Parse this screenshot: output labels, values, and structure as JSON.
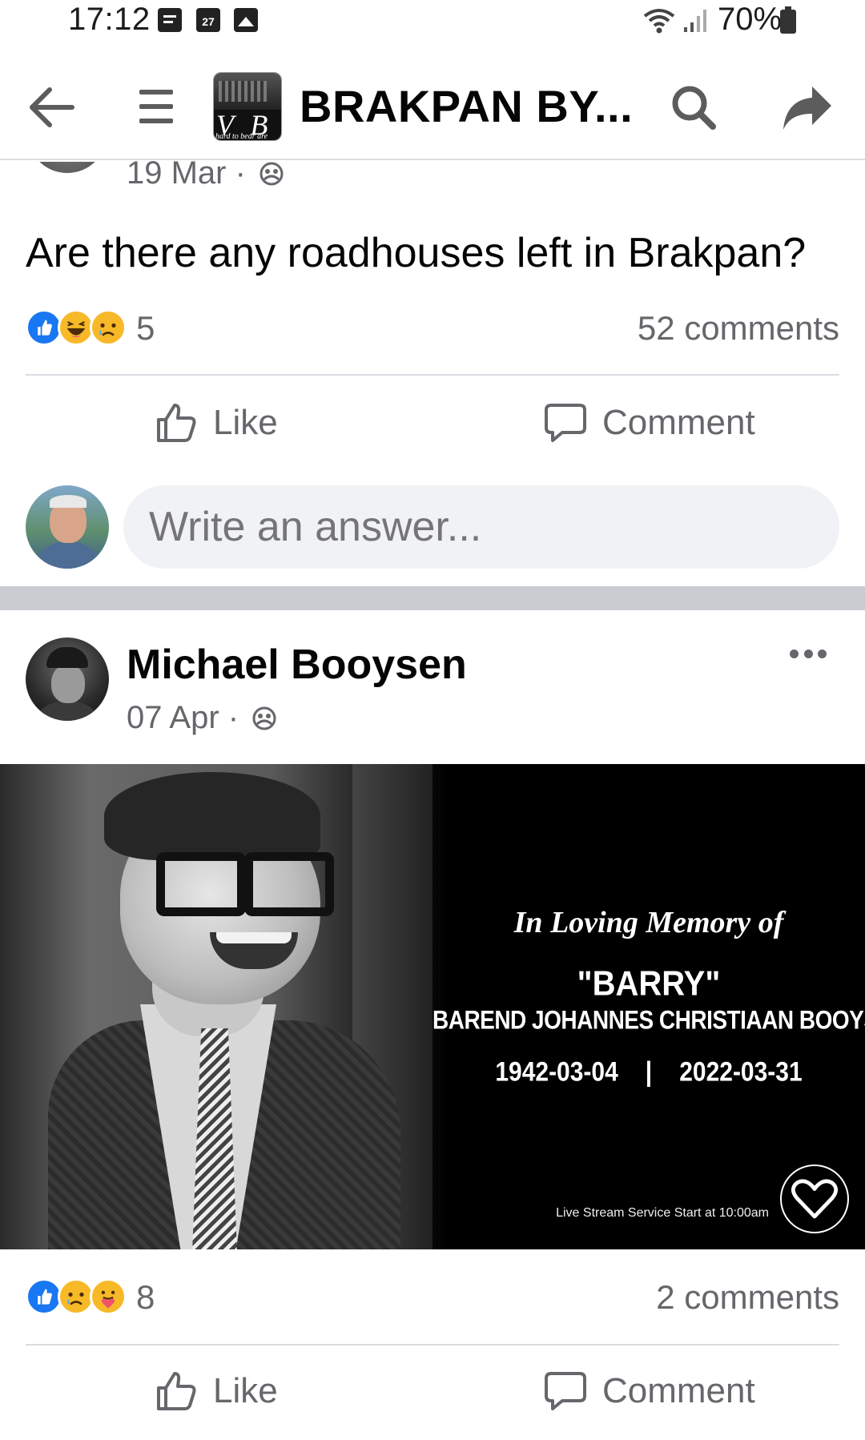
{
  "status_bar": {
    "time": "17:12",
    "calendar_day": "27",
    "battery": "70%"
  },
  "header": {
    "group_name": "BRAKPAN  BY...",
    "logo_letters": "V B",
    "logo_tagline": "hard to bear are"
  },
  "post1": {
    "date": "19 Mar ·",
    "text": "Are there any roadhouses left in Brakpan?",
    "reaction_count": "5",
    "comments": "52 comments",
    "like_label": "Like",
    "comment_label": "Comment",
    "answer_placeholder": "Write an answer..."
  },
  "post2": {
    "author": "Michael Booysen",
    "date": "07 Apr ·",
    "memorial": {
      "title": "In Loving Memory of",
      "nickname": "\"BARRY\"",
      "full_name": "BAREND JOHANNES CHRISTIAAN BOOYSEN",
      "birth": "1942-03-04",
      "separator": "|",
      "death": "2022-03-31",
      "stream_note": "Live Stream Service Start at 10:00am"
    },
    "reaction_count": "8",
    "comments": "2 comments",
    "like_label": "Like",
    "comment_label": "Comment"
  },
  "icons": {
    "back": "arrow-left-icon",
    "menu": "hamburger-icon",
    "search": "search-icon",
    "share": "share-arrow-icon",
    "privacy": "group-members-icon",
    "like": "thumbs-up-icon",
    "comment": "speech-bubble-icon",
    "more": "more-dots-icon"
  },
  "colors": {
    "like_blue": "#1877f2",
    "emoji_yellow": "#f7b928",
    "secondary_text": "#65676b",
    "input_bg": "#f0f2f5",
    "separator": "#c9ccd1"
  }
}
